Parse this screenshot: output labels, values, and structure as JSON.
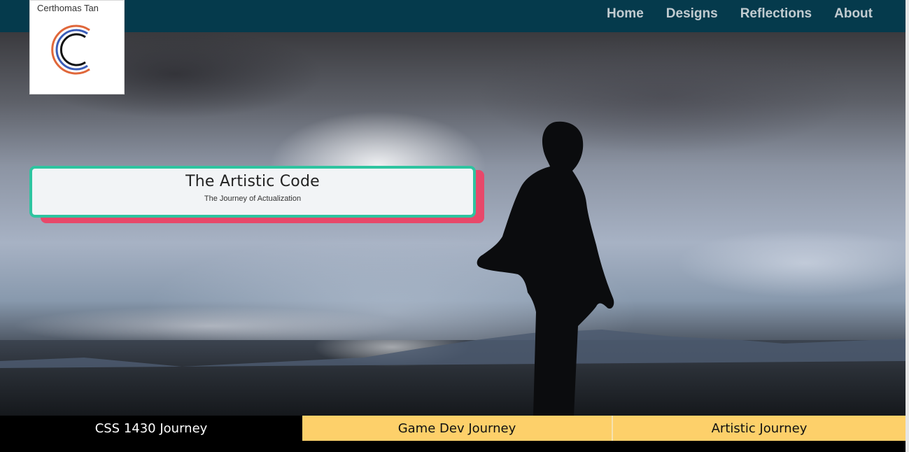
{
  "brand": {
    "name": "Certhomas Tan"
  },
  "nav": {
    "items": [
      {
        "label": "Home"
      },
      {
        "label": "Designs"
      },
      {
        "label": "Reflections"
      },
      {
        "label": "About"
      }
    ]
  },
  "hero": {
    "title": "The Artistic Code",
    "subtitle": "The Journey of Actualization"
  },
  "tabs": [
    {
      "label": "CSS 1430 Journey",
      "active": true
    },
    {
      "label": "Game Dev Journey",
      "active": false
    },
    {
      "label": "Artistic Journey",
      "active": false
    }
  ],
  "colors": {
    "topbar": "#053a4c",
    "card_border": "#2ec4a0",
    "card_shadow": "#e8486a",
    "tab_inactive": "#fdd06a",
    "tab_active": "#000000"
  }
}
